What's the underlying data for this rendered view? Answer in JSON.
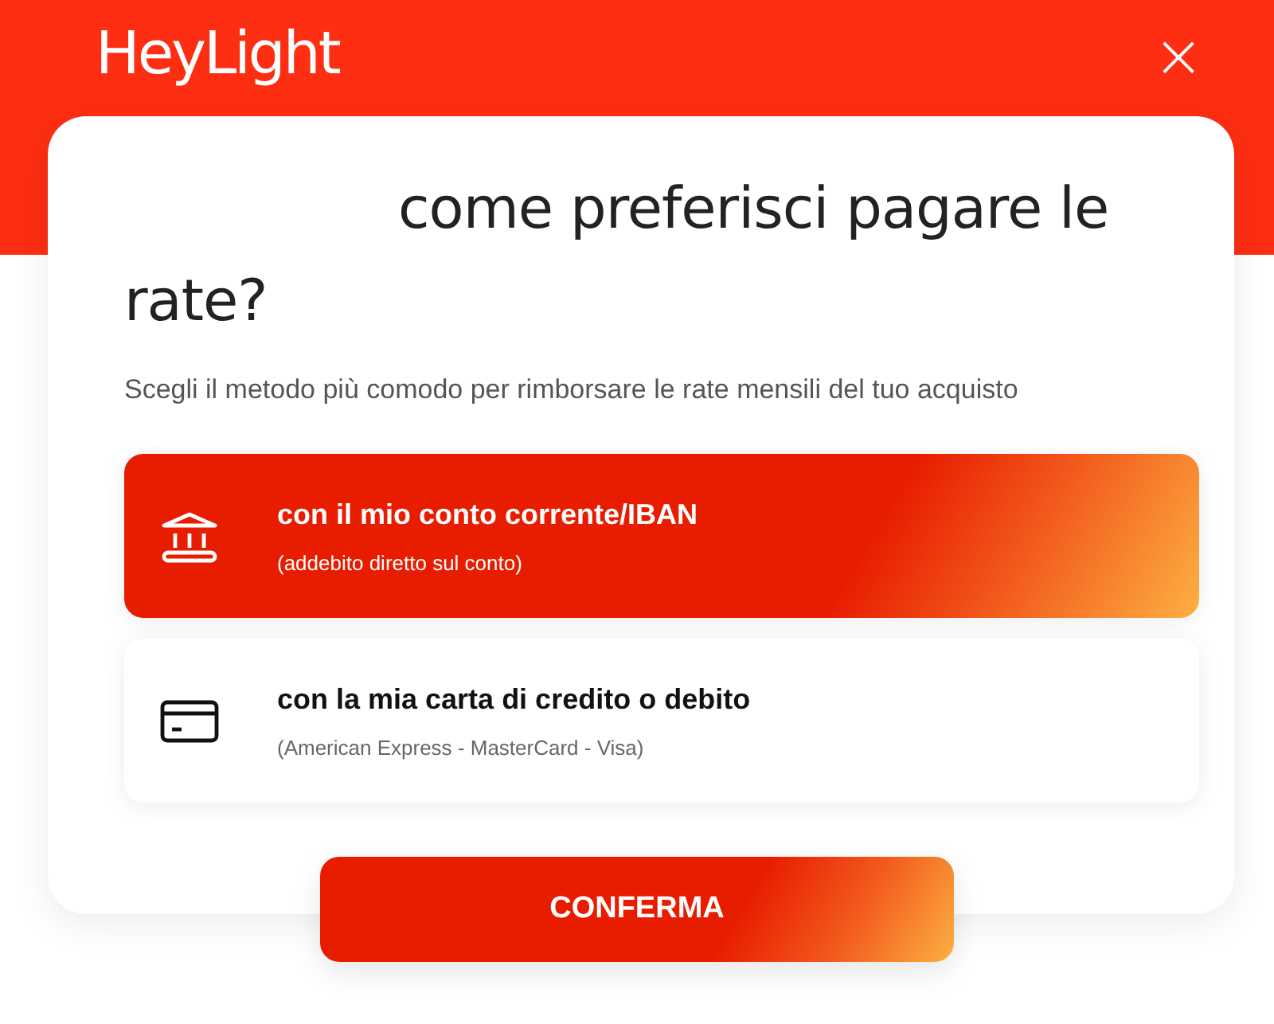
{
  "header": {
    "logo": "HeyLight",
    "close": "×"
  },
  "title": "come preferisci pagare le rate?",
  "subtitle": "Scegli il metodo più comodo per rimborsare le rate mensili del tuo acquisto",
  "options": [
    {
      "kind": "bank",
      "label": "con il mio conto corrente/IBAN",
      "detail": "(addebito diretto sul conto)",
      "selected": true
    },
    {
      "kind": "card",
      "label": "con la mia carta di credito o debito",
      "detail": "(American Express - MasterCard - Visa)",
      "selected": false
    }
  ],
  "confirm_button": "CONFERMA"
}
